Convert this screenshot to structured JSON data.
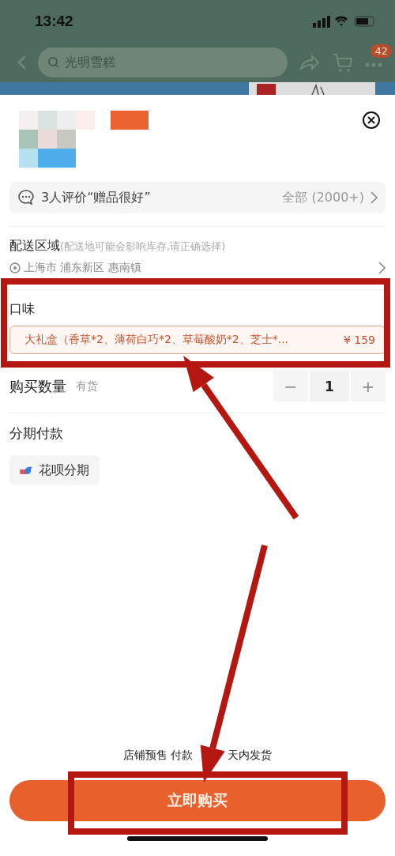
{
  "status_bar": {
    "time": "13:42"
  },
  "nav": {
    "search_placeholder": "光明雪糕",
    "badge": "42"
  },
  "reviews": {
    "summary": "3人评价“赠品很好”",
    "all": "全部 (2000+)"
  },
  "delivery": {
    "label": "配送区域",
    "hint": "(配送地可能会影响库存,请正确选择)",
    "address": "上海市 浦东新区 惠南镇"
  },
  "flavor": {
    "label": "口味",
    "options": [
      {
        "name": "大礼盒（香草*2、薄荷白巧*2、草莓酸奶*2、芝士*...",
        "price": "¥ 159",
        "selected": true
      }
    ]
  },
  "quantity": {
    "label": "购买数量",
    "stock": "有货",
    "value": "1",
    "decrease": "−",
    "increase": "+"
  },
  "installment": {
    "label": "分期付款",
    "options": [
      {
        "name": "花呗分期",
        "selected": false
      }
    ]
  },
  "notice": [
    "店铺预售 付款",
    "天内发货"
  ],
  "buy_button": "立即购买",
  "annotations": [
    {
      "kind": "frame"
    },
    {
      "kind": "arrow"
    },
    {
      "kind": "arrow"
    },
    {
      "kind": "frame"
    }
  ]
}
